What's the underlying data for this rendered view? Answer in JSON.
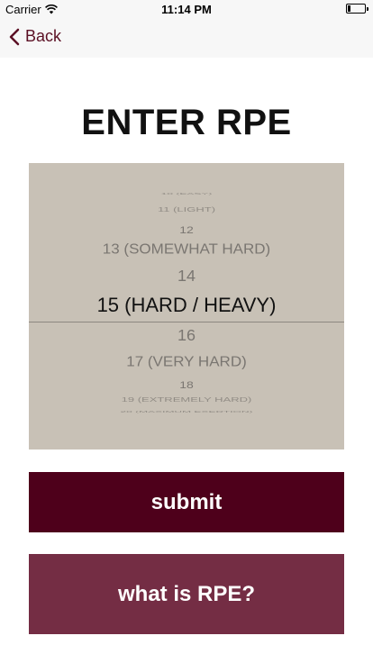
{
  "status_bar": {
    "carrier": "Carrier",
    "time": "11:14 PM",
    "battery_level": 0.15
  },
  "nav": {
    "back_label": "Back",
    "back_icon": "chevron-left-icon",
    "accent_color": "#5b1024"
  },
  "page": {
    "title": "ENTER RPE"
  },
  "picker": {
    "selected_value": "15 (HARD / HEAVY)",
    "items": [
      "10 (EASY)",
      "11 (LIGHT)",
      "12",
      "13 (SOMEWHAT HARD)",
      "14",
      "15 (HARD / HEAVY)",
      "16",
      "17 (VERY HARD)",
      "18",
      "19 (EXTREMELY HARD)",
      "20 (MAXIMUM EXERTION)"
    ]
  },
  "actions": {
    "submit_label": "submit",
    "info_label": "what is RPE?",
    "submit_color": "#4e001b",
    "info_color": "#742d44"
  }
}
